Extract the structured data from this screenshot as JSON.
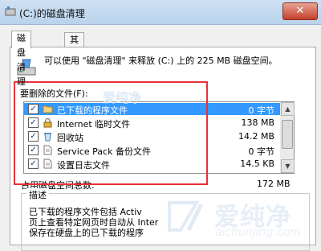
{
  "window": {
    "title": "(C:)的磁盘清理",
    "close_glyph": "✕"
  },
  "tabs": [
    {
      "label": "磁盘清理"
    },
    {
      "label": "其他选项"
    }
  ],
  "info": {
    "text": "可以使用 \"磁盘清理\" 来释放 (C:) 上的 225 MB 磁盘空间。"
  },
  "files": {
    "label": "要删除的文件(F):",
    "items": [
      {
        "name": "已下载的程序文件",
        "size": "0 字节",
        "checked": true,
        "selected": true,
        "icon": "folder-icon"
      },
      {
        "name": "Internet 临时文件",
        "size": "138 MB",
        "checked": true,
        "selected": false,
        "icon": "lock-icon"
      },
      {
        "name": "回收站",
        "size": "14.2 MB",
        "checked": true,
        "selected": false,
        "icon": "recycle-bin-icon"
      },
      {
        "name": "Service Pack 备份文件",
        "size": "0 字节",
        "checked": true,
        "selected": false,
        "icon": "document-icon"
      },
      {
        "name": "设置日志文件",
        "size": "14.5 KB",
        "checked": true,
        "selected": false,
        "icon": "document-icon"
      }
    ]
  },
  "total": {
    "label": "占用磁盘空间总数:",
    "value": "172 MB"
  },
  "description": {
    "title": "描述",
    "lines": [
      "已下载的程序文件包括 Activ",
      "页上查看特定网页时自动从 Inter",
      "保存在硬盘上的已下载的程序"
    ]
  },
  "colors": {
    "selection": "#3399ff",
    "highlight_box": "#e8313a"
  },
  "watermark": {
    "small": "爱纯净",
    "text": "爱纯净",
    "url": "aichunjing.com"
  }
}
